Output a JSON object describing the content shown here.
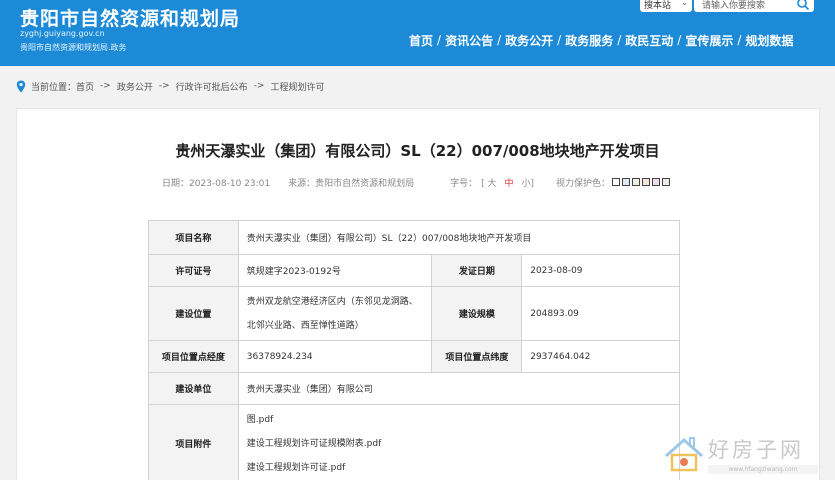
{
  "header": {
    "title": "贵阳市自然资源和规划局",
    "url": "zyghj.guiyang.gov.cn",
    "subtitle": "贵阳市自然资源和规划局.政务",
    "search": {
      "scope": "搜本站",
      "placeholder": "请输入你要搜索"
    },
    "nav": [
      "首页",
      "资讯公告",
      "政务公开",
      "政务服务",
      "政民互动",
      "宣传展示",
      "规划数据"
    ]
  },
  "breadcrumb": {
    "label": "当前位置：",
    "items": [
      "首页",
      "政务公开",
      "行政许可批后公布",
      "工程规划许可"
    ],
    "separator": "->"
  },
  "article": {
    "title": "贵州天瀑实业（集团）有限公司）SL（22）007/008地块地产开发项目",
    "date": "日期：2023-08-10 23:01",
    "source": "来源：贵阳市自然资源和规划局",
    "font_label": "字号：",
    "font_sizes": [
      "[ 大",
      "中",
      "小]"
    ],
    "eye_label": "视力保护色：",
    "eye_colors": [
      "#ffffff",
      "#dbe8f5",
      "#e9f1dc",
      "#f4e3d7",
      "#efdcef",
      "#ececec"
    ]
  },
  "table": {
    "project_name_label": "项目名称",
    "project_name": "贵州天瀑实业（集团）有限公司）SL（22）007/008地块地产开发项目",
    "permit_no_label": "许可证号",
    "permit_no": "筑规建字2023-0192号",
    "issue_date_label": "发证日期",
    "issue_date": "2023-08-09",
    "location_label": "建设位置",
    "location_line1": "贵州双龙航空港经济区内（东邻见龙洞路、",
    "location_line2": "北邻兴业路、西至惮性道路）",
    "scale_label": "建设规模",
    "scale": "204893.09",
    "longitude_label": "项目位置点经度",
    "longitude": "36378924.234",
    "latitude_label": "项目位置点纬度",
    "latitude": "2937464.042",
    "unit_label": "建设单位",
    "unit": "贵州天瀑实业（集团）有限公司",
    "attachments_label": "项目附件",
    "attachments": [
      "图.pdf",
      "建设工程规划许可证规模附表.pdf",
      "建设工程规划许可证.pdf"
    ]
  },
  "watermark": {
    "text": "好房子网",
    "url": "www.hfangziwang.com"
  }
}
